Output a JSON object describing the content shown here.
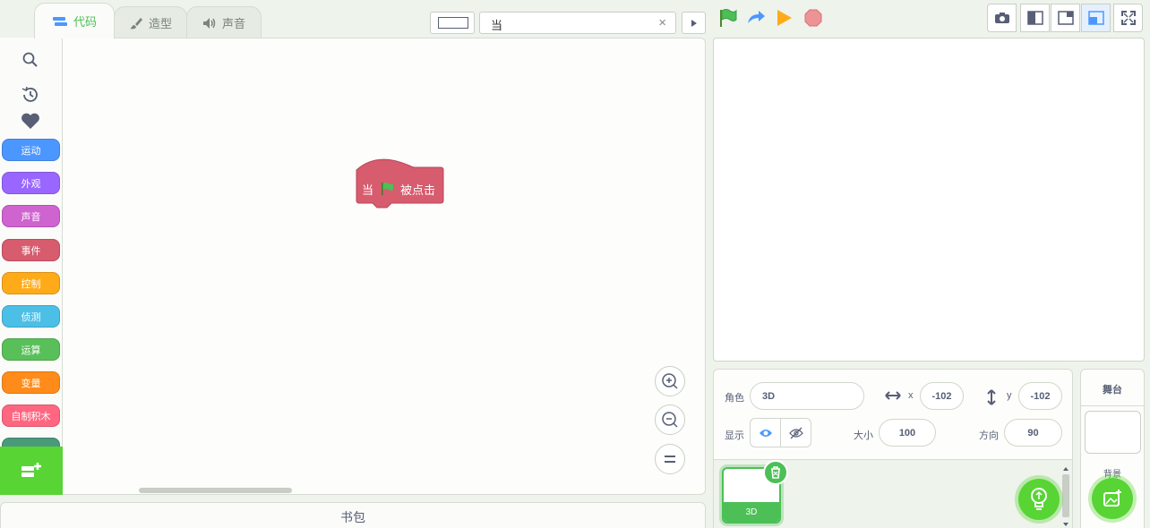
{
  "tabs": [
    {
      "label": "代码",
      "active": true
    },
    {
      "label": "造型",
      "active": false
    },
    {
      "label": "声音",
      "active": false
    }
  ],
  "search": {
    "value": "当",
    "clear": "×"
  },
  "categories": [
    {
      "label": "运动",
      "color": "#4c97ff"
    },
    {
      "label": "外观",
      "color": "#9966ff"
    },
    {
      "label": "声音",
      "color": "#cf63cf"
    },
    {
      "label": "事件",
      "color": "#d65c6e"
    },
    {
      "label": "控制",
      "color": "#ffab19"
    },
    {
      "label": "侦测",
      "color": "#4cbfe6"
    },
    {
      "label": "运算",
      "color": "#59c059"
    },
    {
      "label": "变量",
      "color": "#ff8c1a"
    },
    {
      "label": "自制积木",
      "color": "#ff6680"
    }
  ],
  "hat_block": {
    "before": "当",
    "after": "被点击",
    "color": "#d65c6e",
    "icon": "green-flag-icon"
  },
  "backpack": {
    "label": "书包"
  },
  "sprite": {
    "label": "角色",
    "name": "3D",
    "x_label": "x",
    "x": "-102",
    "y_label": "y",
    "y": "-102",
    "show_label": "显示",
    "size_label": "大小",
    "size": "100",
    "direction_label": "方向",
    "direction": "90"
  },
  "sprite_list": [
    {
      "name": "3D"
    }
  ],
  "stage_pane": {
    "title": "舞台",
    "backdrop_label": "背景"
  },
  "colors": {
    "accent": "#4cbf56",
    "extension_green": "#58d435"
  }
}
